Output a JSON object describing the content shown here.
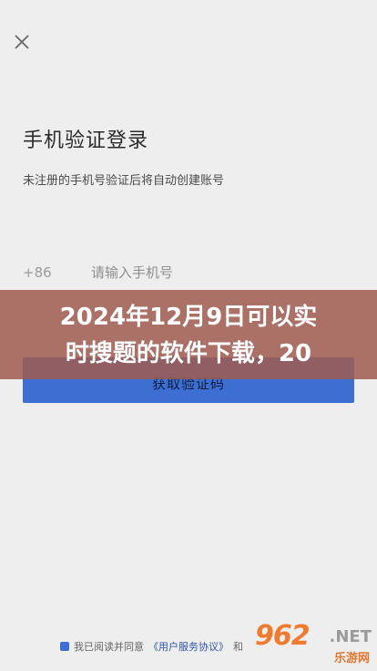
{
  "login": {
    "title": "手机验证登录",
    "subtitle": "未注册的手机号验证后将自动创建账号",
    "country_code": "+86",
    "phone_placeholder": "请输入手机号",
    "get_code_label": "获取验证码"
  },
  "banner": {
    "line1": "2024年12月9日可以实",
    "line2": "时搜题的软件下载，20"
  },
  "agreement": {
    "prefix": "我已阅读并同意",
    "link_label": "《用户服务协议》",
    "suffix": "和"
  },
  "watermark": {
    "brand": "962",
    "domain": ".NET",
    "subtitle": "乐游网"
  },
  "colors": {
    "accent": "#3d6fd2",
    "banner": "#a05c50"
  }
}
